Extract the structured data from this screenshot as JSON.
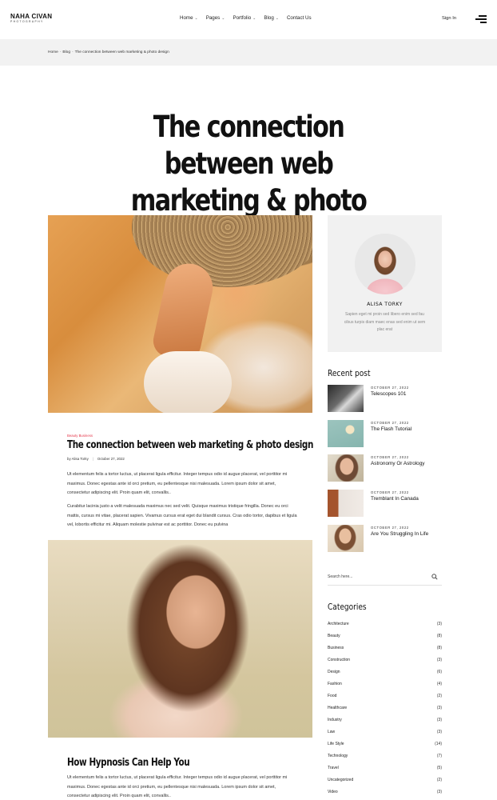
{
  "header": {
    "logo": {
      "main": "NAHA CIVAN",
      "sub": "PHOTOGRAPHY"
    },
    "nav": [
      {
        "label": "Home",
        "has_dropdown": true
      },
      {
        "label": "Pages",
        "has_dropdown": true
      },
      {
        "label": "Portfolio",
        "has_dropdown": true
      },
      {
        "label": "Blog",
        "has_dropdown": true
      },
      {
        "label": "Contact Us",
        "has_dropdown": false
      }
    ],
    "signin": "Sign In",
    "menu_icon": "hamburger-icon"
  },
  "breadcrumb": {
    "items": [
      "Home",
      "Blog",
      "The connection between web marketing & photo design"
    ],
    "separator": "-"
  },
  "page_title": {
    "line1": "The connection between web",
    "line2": "marketing & photo design"
  },
  "posts": [
    {
      "category": "Beauty Business",
      "title": "The connection between web marketing & photo design",
      "author": "by Alisa Torky",
      "date": "October 27, 2022",
      "paragraphs": [
        "Ut elementum felis a tortor luctus, ut placerat ligula efficitur. Integer tempus odio id augue placerat, vel porttitor mi maximus. Donec egestas ante id orci pretium, eu pellentesque nisi malesuada. Lorem ipsum dolor sit amet, consectetur adipiscing elit. Proin quam elit, convallis..",
        "Curabitur lacinia justo a velit malesuada maximus nec sed velit. Quisque maximus tristique fringilla. Donec eu orci mattis, cursus mi vitae, placerat sapien. Vivamus cursus erat eget dui blandit cursus. Cras odio tortor, dapibus et ligula vel, lobortis efficitur mi. Aliquam molestie pulvinar est ac porttitor. Donec eu pulvina"
      ]
    },
    {
      "title": "How Hypnosis Can Help You",
      "paragraphs": [
        "Ut elementum felis a tortor luctus, ut placerat ligula efficitur. Integer tempus odio id augue placerat, vel porttitor mi maximus. Donec egestas ante id orci pretium, eu pellentesque nisi malesuada. Lorem ipsum dolor sit amet, consectetur adipiscing elit. Proin quam elit, convallis.."
      ]
    }
  ],
  "sidebar": {
    "author": {
      "name": "ALISA TORKY",
      "bio": "Sapien eget mi proin sed libero enim sed fau cibus turpis diam maec enas sed enim ut sem plac erat"
    },
    "recent_heading": "Recent post",
    "recent_posts": [
      {
        "date": "OCTOBER 27, 2022",
        "title": "Telescopes 101"
      },
      {
        "date": "OCTOBER 27, 2022",
        "title": "The Flash Tutorial"
      },
      {
        "date": "OCTOBER 27, 2022",
        "title": "Astronomy Or Astrology"
      },
      {
        "date": "OCTOBER 27, 2022",
        "title": "Tremblant In Canada"
      },
      {
        "date": "OCTOBER 27, 2022",
        "title": "Are You Struggling In Life"
      }
    ],
    "search": {
      "placeholder": "Search here..."
    },
    "categories_heading": "Categories",
    "categories": [
      {
        "name": "Architecture",
        "count": "(3)"
      },
      {
        "name": "Beauty",
        "count": "(8)"
      },
      {
        "name": "Business",
        "count": "(8)"
      },
      {
        "name": "Construction",
        "count": "(3)"
      },
      {
        "name": "Design",
        "count": "(6)"
      },
      {
        "name": "Fashion",
        "count": "(4)"
      },
      {
        "name": "Food",
        "count": "(2)"
      },
      {
        "name": "Healthcare",
        "count": "(3)"
      },
      {
        "name": "Industry",
        "count": "(3)"
      },
      {
        "name": "Law",
        "count": "(3)"
      },
      {
        "name": "Life Style",
        "count": "(14)"
      },
      {
        "name": "Technology",
        "count": "(7)"
      },
      {
        "name": "Travel",
        "count": "(5)"
      },
      {
        "name": "Uncategorized",
        "count": "(2)"
      },
      {
        "name": "Video",
        "count": "(3)"
      }
    ]
  }
}
